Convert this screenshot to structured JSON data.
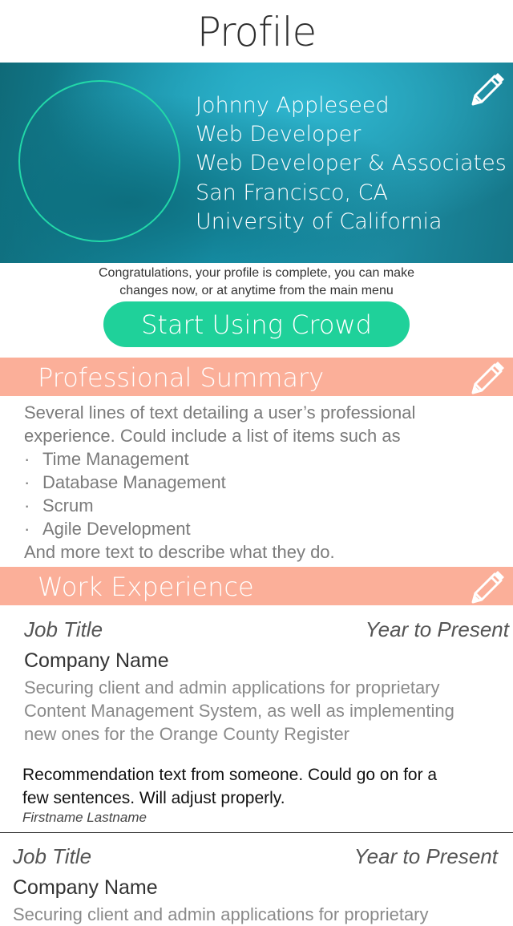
{
  "navbar": {
    "title": "Profile"
  },
  "profile": {
    "name": "Johnny Appleseed",
    "title": "Web Developer",
    "company": "Web Developer & Associates",
    "location": "San Francisco, CA",
    "school": "University of California",
    "edit_icon": "pencil-icon"
  },
  "congrats": {
    "line1": "Congratulations, your profile is complete, you can make",
    "line2": "changes now, or at anytime from the main menu"
  },
  "cta": {
    "label": "Start Using Crowd",
    "color": "#1fd19a"
  },
  "colors": {
    "section_header": "#fbaf99",
    "hero_accent": "#1a9bb5",
    "avatar_ring": "#22d8a8"
  },
  "summary": {
    "header": "Professional Summary",
    "line1": "Several lines of text detailing a user’s professional",
    "line2": "experience.  Could include a list of items such as",
    "bullets": [
      "Time Management",
      "Database Management",
      "Scrum",
      "Agile Development"
    ],
    "bullet_char": "·",
    "closing": "And more text to describe what they do."
  },
  "work": {
    "header": "Work Experience",
    "jobs": [
      {
        "job_title": "Job Title",
        "years": "Year to Present",
        "company": "Company Name",
        "desc1": "Securing client and admin applications for proprietary",
        "desc2": "Content Management System, as well as implementing",
        "desc3": "new ones for the Orange County Register"
      },
      {
        "job_title": "Job Title",
        "years": "Year to Present",
        "company": "Company Name",
        "desc1": "Securing client and admin applications for proprietary"
      }
    ],
    "recommendation": {
      "line1": "Recommendation text from someone.  Could go on for a",
      "line2": "few sentences.  Will adjust properly.",
      "author": "Firstname Lastname"
    }
  }
}
